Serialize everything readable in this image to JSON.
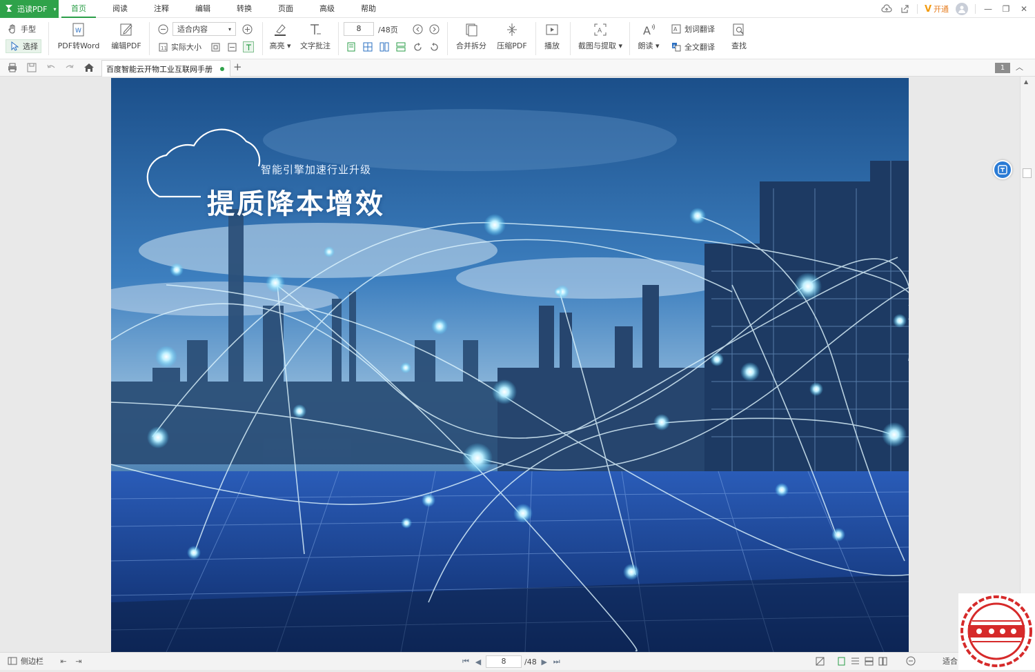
{
  "app": {
    "name": "迅读PDF"
  },
  "menu": [
    {
      "label": "首页",
      "active": true
    },
    {
      "label": "阅读"
    },
    {
      "label": "注释"
    },
    {
      "label": "编辑"
    },
    {
      "label": "转换"
    },
    {
      "label": "页面"
    },
    {
      "label": "高级"
    },
    {
      "label": "帮助"
    }
  ],
  "window": {
    "vip_label": "开通"
  },
  "ribbon": {
    "hand": "手型",
    "select": "选择",
    "pdf_to_word": "PDF转Word",
    "edit_pdf": "编辑PDF",
    "zoom_mode": "适合内容",
    "actual_size": "实际大小",
    "highlight": "高亮",
    "text_note": "文字批注",
    "page_input": "8",
    "page_total": "/48页",
    "merge_split": "合并拆分",
    "compress": "压缩PDF",
    "play": "播放",
    "screenshot": "截图与提取",
    "read_aloud": "朗读",
    "word_translate": "划词翻译",
    "full_translate": "全文翻译",
    "find": "查找"
  },
  "tabs": [
    {
      "title": "百度智能云开物工业互联网手册"
    }
  ],
  "page_badge": "1",
  "document": {
    "subtitle": "智能引擎加速行业升级",
    "title": "提质降本增效"
  },
  "status": {
    "sidebar": "侧边栏",
    "current_page": "8",
    "total_pages": "/48",
    "zoom": "适合"
  },
  "colors": {
    "brand_green": "#2fa24a",
    "sky_dark": "#1b4f8a",
    "panel_blue": "#1f4fa8",
    "stamp_red": "#d62a2a"
  }
}
